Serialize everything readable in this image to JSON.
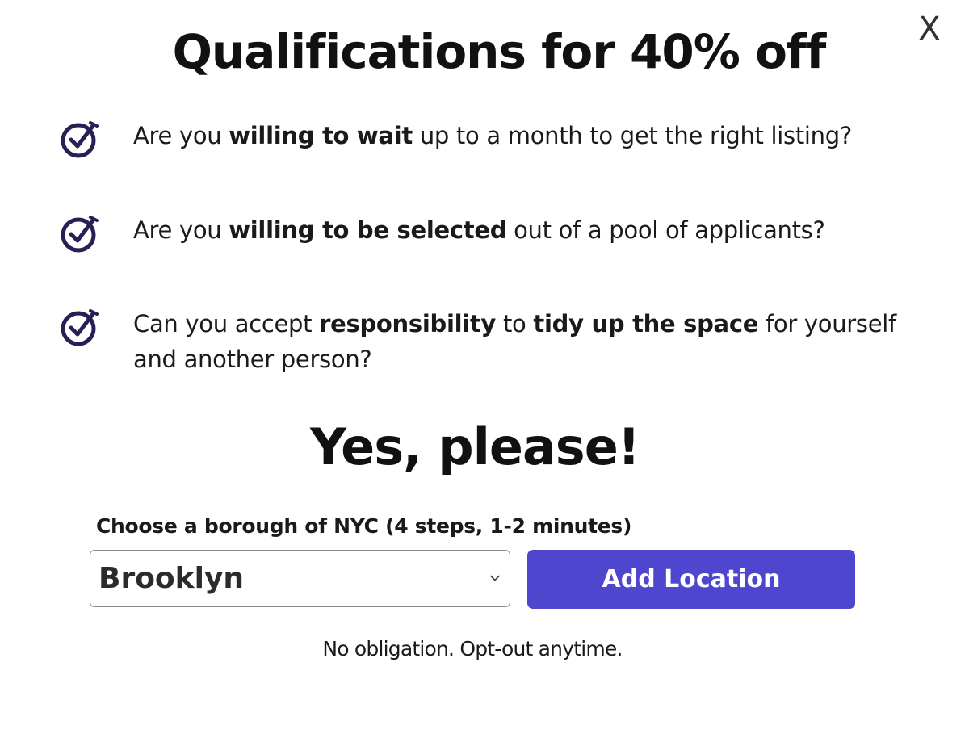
{
  "modal": {
    "close_label": "X",
    "title": "Qualifications for 40% off"
  },
  "qualifications": [
    {
      "icon": "check-circle-icon",
      "prefix": "Are you ",
      "bold1": "willing to wait",
      "middle": " up to a month to get the right listing?",
      "bold2": "",
      "suffix": ""
    },
    {
      "icon": "check-circle-icon",
      "prefix": "Are you ",
      "bold1": "willing to be selected",
      "middle": " out of a pool of applicants?",
      "bold2": "",
      "suffix": ""
    },
    {
      "icon": "check-circle-icon",
      "prefix": "Can you accept ",
      "bold1": "responsibility",
      "middle": " to ",
      "bold2": "tidy up the space",
      "suffix": " for yourself and another person?"
    }
  ],
  "cta": {
    "heading": "Yes, please!",
    "borough_label": "Choose a borough of NYC (4 steps, 1-2 minutes)",
    "selected_borough": "Brooklyn",
    "button_label": "Add Location",
    "note": "No obligation. Opt-out anytime."
  },
  "colors": {
    "accent": "#4f46cf",
    "check_icon": "#2a1f55"
  }
}
